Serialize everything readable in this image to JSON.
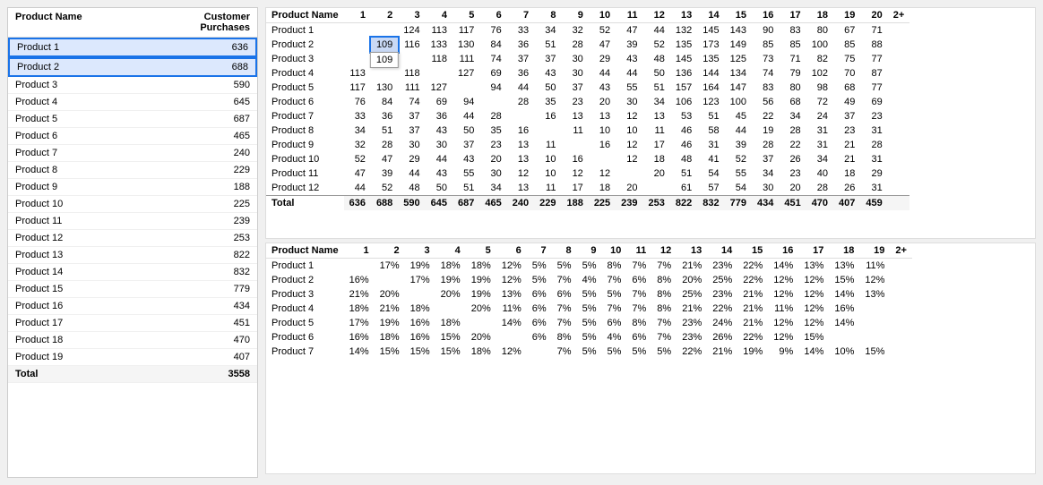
{
  "leftPanel": {
    "columns": [
      "Product Name",
      "Customer Purchases"
    ],
    "rows": [
      {
        "name": "Product 1",
        "value": 636,
        "selected": true
      },
      {
        "name": "Product 2",
        "value": 688,
        "selected": true
      },
      {
        "name": "Product 3",
        "value": 590
      },
      {
        "name": "Product 4",
        "value": 645
      },
      {
        "name": "Product 5",
        "value": 687
      },
      {
        "name": "Product 6",
        "value": 465
      },
      {
        "name": "Product 7",
        "value": 240
      },
      {
        "name": "Product 8",
        "value": 229
      },
      {
        "name": "Product 9",
        "value": 188
      },
      {
        "name": "Product 10",
        "value": 225
      },
      {
        "name": "Product 11",
        "value": 239
      },
      {
        "name": "Product 12",
        "value": 253
      },
      {
        "name": "Product 13",
        "value": 822
      },
      {
        "name": "Product 14",
        "value": 832
      },
      {
        "name": "Product 15",
        "value": 779
      },
      {
        "name": "Product 16",
        "value": 434
      },
      {
        "name": "Product 17",
        "value": 451
      },
      {
        "name": "Product 18",
        "value": 470
      },
      {
        "name": "Product 19",
        "value": 407
      }
    ],
    "total": {
      "name": "Total",
      "value": 3558
    }
  },
  "topTable": {
    "colHeaders": [
      "Product Name",
      "1",
      "2",
      "3",
      "4",
      "5",
      "6",
      "7",
      "8",
      "9",
      "10",
      "11",
      "12",
      "13",
      "14",
      "15",
      "16",
      "17",
      "18",
      "19",
      "20",
      "2+"
    ],
    "rows": [
      {
        "name": "Product 1",
        "cells": [
          null,
          null,
          124,
          113,
          117,
          76,
          33,
          34,
          32,
          52,
          47,
          44,
          132,
          145,
          143,
          90,
          83,
          80,
          67,
          71,
          null
        ],
        "highlight": false
      },
      {
        "name": "Product 2",
        "cells": [
          null,
          109,
          116,
          133,
          130,
          84,
          36,
          51,
          28,
          47,
          39,
          52,
          135,
          173,
          149,
          85,
          85,
          100,
          85,
          88,
          null
        ],
        "highlight": true,
        "tooltipCol": 1,
        "tooltipVal": "109"
      },
      {
        "name": "Product 3",
        "cells": [
          null,
          null,
          null,
          118,
          111,
          74,
          37,
          37,
          30,
          29,
          43,
          48,
          145,
          135,
          125,
          73,
          71,
          82,
          75,
          77,
          null
        ]
      },
      {
        "name": "Product 4",
        "cells": [
          113,
          null,
          118,
          null,
          127,
          69,
          36,
          43,
          30,
          44,
          44,
          50,
          136,
          144,
          134,
          74,
          79,
          102,
          70,
          87,
          null
        ]
      },
      {
        "name": "Product 5",
        "cells": [
          117,
          130,
          111,
          127,
          null,
          94,
          44,
          50,
          37,
          43,
          55,
          51,
          157,
          164,
          147,
          83,
          80,
          98,
          68,
          77,
          null
        ]
      },
      {
        "name": "Product 6",
        "cells": [
          76,
          84,
          74,
          69,
          94,
          null,
          28,
          35,
          23,
          20,
          30,
          34,
          106,
          123,
          100,
          56,
          68,
          72,
          49,
          69,
          null
        ]
      },
      {
        "name": "Product 7",
        "cells": [
          33,
          36,
          37,
          36,
          44,
          28,
          null,
          16,
          13,
          13,
          12,
          13,
          53,
          51,
          45,
          22,
          34,
          24,
          37,
          23,
          null
        ]
      },
      {
        "name": "Product 8",
        "cells": [
          34,
          51,
          37,
          43,
          50,
          35,
          16,
          null,
          11,
          10,
          10,
          11,
          46,
          58,
          44,
          19,
          28,
          31,
          23,
          31,
          null
        ]
      },
      {
        "name": "Product 9",
        "cells": [
          32,
          28,
          30,
          30,
          37,
          23,
          13,
          11,
          null,
          16,
          12,
          17,
          46,
          31,
          39,
          28,
          22,
          31,
          21,
          28,
          null
        ]
      },
      {
        "name": "Product 10",
        "cells": [
          52,
          47,
          29,
          44,
          43,
          20,
          13,
          10,
          16,
          null,
          12,
          18,
          48,
          41,
          52,
          37,
          26,
          34,
          21,
          31,
          null
        ]
      },
      {
        "name": "Product 11",
        "cells": [
          47,
          39,
          44,
          43,
          55,
          30,
          12,
          10,
          12,
          12,
          null,
          20,
          51,
          54,
          55,
          34,
          23,
          40,
          18,
          29,
          null
        ]
      },
      {
        "name": "Product 12",
        "cells": [
          44,
          52,
          48,
          50,
          51,
          34,
          13,
          11,
          17,
          18,
          20,
          null,
          61,
          57,
          54,
          30,
          20,
          28,
          26,
          31,
          null
        ]
      }
    ],
    "totalRow": {
      "name": "Total",
      "cells": [
        636,
        688,
        590,
        645,
        687,
        465,
        240,
        229,
        188,
        225,
        239,
        253,
        822,
        832,
        779,
        434,
        451,
        470,
        407,
        459,
        null
      ]
    }
  },
  "bottomTable": {
    "colHeaders": [
      "Product Name",
      "1",
      "2",
      "3",
      "4",
      "5",
      "6",
      "7",
      "8",
      "9",
      "10",
      "11",
      "12",
      "13",
      "14",
      "15",
      "16",
      "17",
      "18",
      "19",
      "2+"
    ],
    "rows": [
      {
        "name": "Product 1",
        "cells": [
          null,
          "17%",
          "19%",
          "18%",
          "18%",
          "12%",
          "5%",
          "5%",
          "5%",
          "8%",
          "7%",
          "7%",
          "21%",
          "23%",
          "22%",
          "14%",
          "13%",
          "13%",
          "11%",
          null
        ]
      },
      {
        "name": "Product 2",
        "cells": [
          "16%",
          null,
          "17%",
          "19%",
          "19%",
          "12%",
          "5%",
          "7%",
          "4%",
          "7%",
          "6%",
          "8%",
          "20%",
          "25%",
          "22%",
          "12%",
          "12%",
          "15%",
          "12%",
          null
        ]
      },
      {
        "name": "Product 3",
        "cells": [
          "21%",
          "20%",
          null,
          "20%",
          "19%",
          "13%",
          "6%",
          "6%",
          "5%",
          "5%",
          "7%",
          "8%",
          "25%",
          "23%",
          "21%",
          "12%",
          "12%",
          "14%",
          "13%",
          null
        ]
      },
      {
        "name": "Product 4",
        "cells": [
          "18%",
          "21%",
          "18%",
          null,
          "20%",
          "11%",
          "6%",
          "7%",
          "5%",
          "7%",
          "7%",
          "8%",
          "21%",
          "22%",
          "21%",
          "11%",
          "12%",
          "16%",
          null,
          null
        ]
      },
      {
        "name": "Product 5",
        "cells": [
          "17%",
          "19%",
          "16%",
          "18%",
          null,
          "14%",
          "6%",
          "7%",
          "5%",
          "6%",
          "8%",
          "7%",
          "23%",
          "24%",
          "21%",
          "12%",
          "12%",
          "14%",
          null,
          null
        ]
      },
      {
        "name": "Product 6",
        "cells": [
          "16%",
          "18%",
          "16%",
          "15%",
          "20%",
          null,
          "6%",
          "8%",
          "5%",
          "4%",
          "6%",
          "7%",
          "23%",
          "26%",
          "22%",
          "12%",
          "15%",
          null,
          null,
          null
        ]
      },
      {
        "name": "Product 7",
        "cells": [
          "14%",
          "15%",
          "15%",
          "15%",
          "18%",
          "12%",
          null,
          "7%",
          "5%",
          "5%",
          "5%",
          "5%",
          "22%",
          "21%",
          "19%",
          "9%",
          "14%",
          "10%",
          "15%",
          null
        ]
      }
    ]
  },
  "tooltip": {
    "value": "109",
    "visible": true
  }
}
